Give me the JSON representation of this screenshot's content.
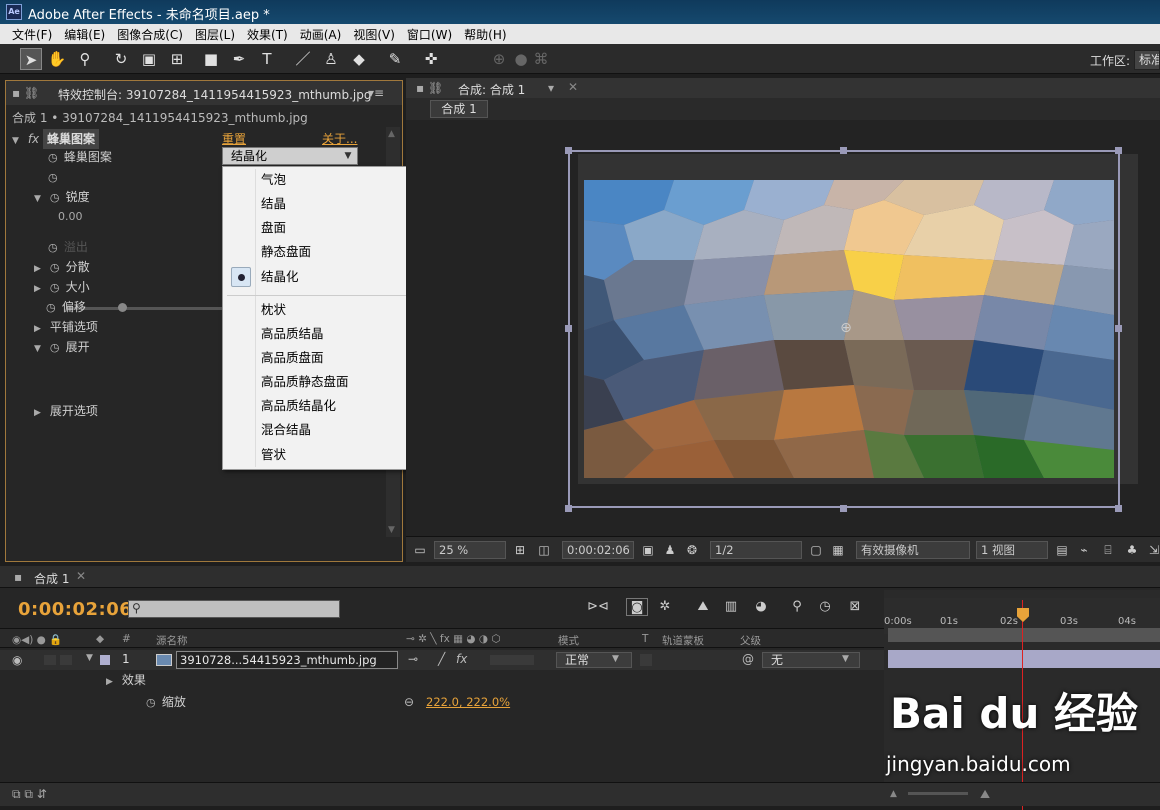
{
  "window": {
    "title": "Adobe After Effects - 未命名项目.aep *",
    "app_icon": "Ae"
  },
  "menu": [
    "文件(F)",
    "编辑(E)",
    "图像合成(C)",
    "图层(L)",
    "效果(T)",
    "动画(A)",
    "视图(V)",
    "窗口(W)",
    "帮助(H)"
  ],
  "toolbar": {
    "workspace_label": "工作区:",
    "workspace_value": "标准"
  },
  "effects_panel": {
    "tab_title": "特效控制台: 39107284_1411954415923_mthumb.jpg",
    "subtitle": "合成 1 • 39107284_1411954415923_mthumb.jpg",
    "effect_name": "蜂巢图案",
    "reset": "重置",
    "about": "关于...",
    "props": {
      "pattern": "蜂巢图案",
      "sharpness": "锐度",
      "sharpness_value": "0.00",
      "overflow": "溢出",
      "scatter": "分散",
      "size": "大小",
      "offset": "偏移",
      "tiling": "平铺选项",
      "evolution": "展开",
      "evolution_opts": "展开选项"
    },
    "dropdown_value": "结晶化"
  },
  "dropdown_menu": {
    "items_group1": [
      "气泡",
      "结晶",
      "盘面",
      "静态盘面",
      "结晶化"
    ],
    "items_group2": [
      "枕状",
      "高品质结晶",
      "高品质盘面",
      "高品质静态盘面",
      "高品质结晶化",
      "混合结晶",
      "管状"
    ],
    "selected": "结晶化"
  },
  "comp_panel": {
    "tab_title": "合成: 合成 1",
    "sub_tab": "合成 1",
    "zoom": "25 %",
    "timecode": "0:00:02:06",
    "resolution": "1/2",
    "camera": "有效摄像机",
    "views": "1 视图"
  },
  "timeline": {
    "tab": "合成 1",
    "timecode": "0:00:02:06",
    "col_num": "#",
    "col_source": "源名称",
    "col_mode": "模式",
    "col_t": "T",
    "col_trkmat": "轨道蒙板",
    "col_parent": "父级",
    "layer_index": "1",
    "layer_name": "3910728...54415923_mthumb.jpg",
    "layer_mode": "正常",
    "layer_parent": "无",
    "effects_label": "效果",
    "scale_label": "缩放",
    "scale_value": "222.0, 222.0%",
    "ruler": [
      "0:00s",
      "01s",
      "02s",
      "03s",
      "04s"
    ]
  },
  "watermark": {
    "brand": "Bai du 经验",
    "url": "jingyan.baidu.com"
  }
}
